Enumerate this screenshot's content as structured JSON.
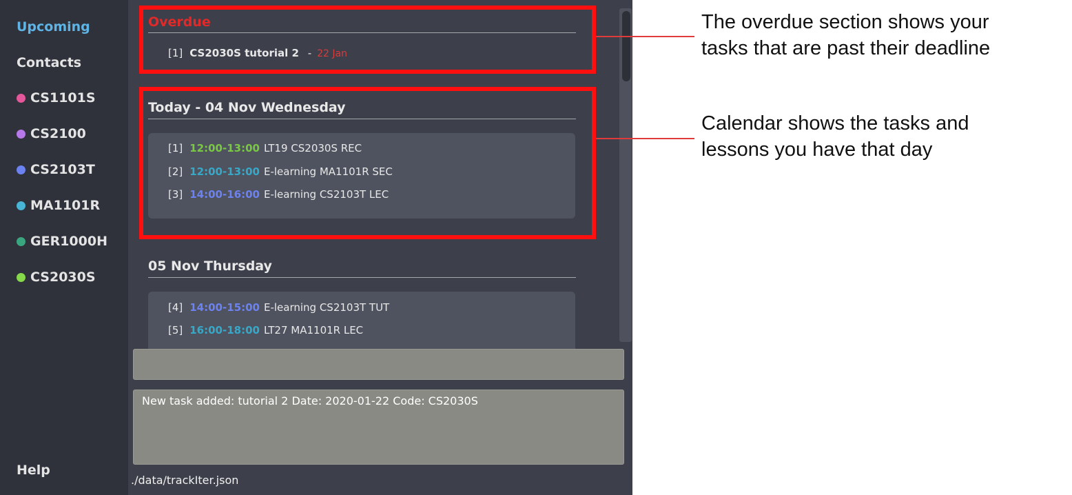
{
  "sidebar": {
    "nav": {
      "upcoming": "Upcoming",
      "contacts": "Contacts",
      "help": "Help"
    },
    "modules": [
      {
        "code": "CS1101S",
        "color": "#e4579a"
      },
      {
        "code": "CS2100",
        "color": "#b779ea"
      },
      {
        "code": "CS2103T",
        "color": "#6b82f0"
      },
      {
        "code": "MA1101R",
        "color": "#49b5d6"
      },
      {
        "code": "GER1000H",
        "color": "#3aa67f"
      },
      {
        "code": "CS2030S",
        "color": "#86d94a"
      }
    ]
  },
  "overdue": {
    "title": "Overdue",
    "tasks": [
      {
        "index": "[1]",
        "name": "CS2030S tutorial 2",
        "separator": "-",
        "date": "22 Jan"
      }
    ]
  },
  "today": {
    "title": "Today - 04 Nov Wednesday",
    "events": [
      {
        "index": "[1]",
        "time": "12:00-13:00",
        "time_color": "#7ac943",
        "desc": "LT19 CS2030S REC"
      },
      {
        "index": "[2]",
        "time": "12:00-13:00",
        "time_color": "#36a9c9",
        "desc": "E-learning MA1101R SEC"
      },
      {
        "index": "[3]",
        "time": "14:00-16:00",
        "time_color": "#6b82f0",
        "desc": "E-learning CS2103T LEC"
      }
    ]
  },
  "next_day": {
    "title": "05 Nov Thursday",
    "events": [
      {
        "index": "[4]",
        "time": "14:00-15:00",
        "time_color": "#6b82f0",
        "desc": "E-learning CS2103T TUT"
      },
      {
        "index": "[5]",
        "time": "16:00-18:00",
        "time_color": "#36a9c9",
        "desc": "LT27 MA1101R LEC"
      }
    ]
  },
  "command_box": {
    "value": ""
  },
  "result": {
    "text": "New task added: tutorial 2 Date: 2020-01-22 Code: CS2030S"
  },
  "status_bar": {
    "path": "./data/trackIter.json"
  },
  "annotations": {
    "overdue_line1": "The overdue section shows your",
    "overdue_line2": "tasks that are past their deadline",
    "calendar_line1": "Calendar shows the tasks and",
    "calendar_line2": "lessons you have that day"
  },
  "colors": {
    "highlight_box": "#ff1010",
    "annot_line": "#e03a3a",
    "overdue": "#e02a2a",
    "active_nav": "#5fb4e6"
  }
}
